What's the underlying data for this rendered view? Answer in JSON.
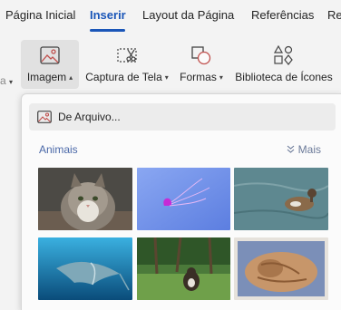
{
  "tabs": [
    {
      "label": "Página Inicial"
    },
    {
      "label": "Inserir"
    },
    {
      "label": "Layout da Página"
    },
    {
      "label": "Referências"
    },
    {
      "label": "Re"
    }
  ],
  "toolbar": {
    "left_stub": "a",
    "image_label": "Imagem",
    "screenshot_label": "Captura de Tela",
    "shapes_label": "Formas",
    "icons_label": "Biblioteca de Ícones"
  },
  "dropdown": {
    "from_file_label": "De Arquivo...",
    "section_title": "Animais",
    "more_label": "Mais",
    "images": [
      {
        "icon": "cat-photo"
      },
      {
        "icon": "jellyfish-photo"
      },
      {
        "icon": "duck-photo"
      },
      {
        "icon": "manta-ray-photo"
      },
      {
        "icon": "cat-in-orchard-photo"
      },
      {
        "icon": "sleeping-cat-photo"
      }
    ]
  },
  "colors": {
    "accent": "#1a56b8",
    "section": "#4a68a8"
  }
}
